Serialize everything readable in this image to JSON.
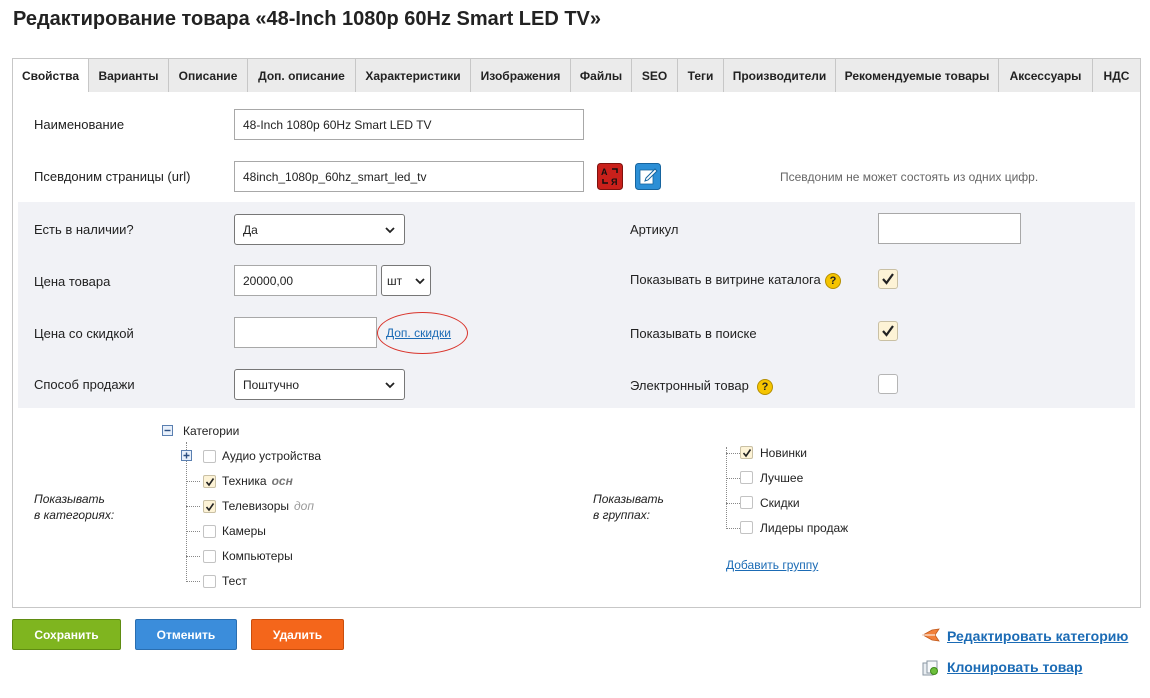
{
  "page": {
    "title": "Редактирование товара «48-Inch 1080p 60Hz Smart LED TV»"
  },
  "tabs": [
    {
      "label": "Свойства",
      "active": true
    },
    {
      "label": "Варианты"
    },
    {
      "label": "Описание"
    },
    {
      "label": "Доп. описание"
    },
    {
      "label": "Характеристики"
    },
    {
      "label": "Изображения"
    },
    {
      "label": "Файлы"
    },
    {
      "label": "SEO"
    },
    {
      "label": "Теги"
    },
    {
      "label": "Производители"
    },
    {
      "label": "Рекомендуемые товары"
    },
    {
      "label": "Аксессуары"
    },
    {
      "label": "НДС"
    }
  ],
  "form": {
    "name_label": "Наименование",
    "name_value": "48-Inch 1080p 60Hz Smart LED TV",
    "url_label": "Псевдоним страницы (url)",
    "url_value": "48inch_1080p_60hz_smart_led_tv",
    "url_hint": "Псевдоним не может состоять из одних цифр.",
    "stock_label": "Есть в наличии?",
    "stock_value": "Да",
    "price_label": "Цена товара",
    "price_value": "20000,00",
    "unit_value": "шт",
    "discount_label": "Цена со скидкой",
    "discount_value": "",
    "discount_link": "Доп. скидки",
    "sale_label": "Способ продажи",
    "sale_value": "Поштучно",
    "article_label": "Артикул",
    "article_value": "",
    "showcase_label": "Показывать в витрине каталога",
    "showcase_checked": true,
    "search_label": "Показывать в поиске",
    "search_checked": true,
    "digital_label": "Электронный товар",
    "digital_checked": false
  },
  "categories": {
    "side_label_1": "Показывать",
    "side_label_2": "в категориях:",
    "root": "Категории",
    "items": [
      {
        "label": "Аудио устройства",
        "checked": false,
        "tag": "",
        "expandable": true
      },
      {
        "label": "Техника",
        "checked": true,
        "tag": "осн"
      },
      {
        "label": "Телевизоры",
        "checked": true,
        "tag": "доп"
      },
      {
        "label": "Камеры",
        "checked": false,
        "tag": ""
      },
      {
        "label": "Компьютеры",
        "checked": false,
        "tag": ""
      },
      {
        "label": "Тест",
        "checked": false,
        "tag": ""
      }
    ]
  },
  "groups": {
    "side_label_1": "Показывать",
    "side_label_2": "в группах:",
    "items": [
      {
        "label": "Новинки",
        "checked": true
      },
      {
        "label": "Лучшее",
        "checked": false
      },
      {
        "label": "Скидки",
        "checked": false
      },
      {
        "label": "Лидеры продаж",
        "checked": false
      }
    ],
    "add_link": "Добавить группу"
  },
  "actions": {
    "save": "Сохранить",
    "cancel": "Отменить",
    "delete": "Удалить",
    "edit_category": "Редактировать категорию",
    "clone": "Клонировать товар"
  },
  "colors": {
    "save": "#7fb51f",
    "cancel": "#3b8ddb",
    "delete": "#f4661b",
    "link": "#1b6bb5",
    "highlight_circle": "#d9342b"
  },
  "icons": {
    "help": "question-icon",
    "translit": "translit-icon",
    "edit": "edit-icon"
  }
}
